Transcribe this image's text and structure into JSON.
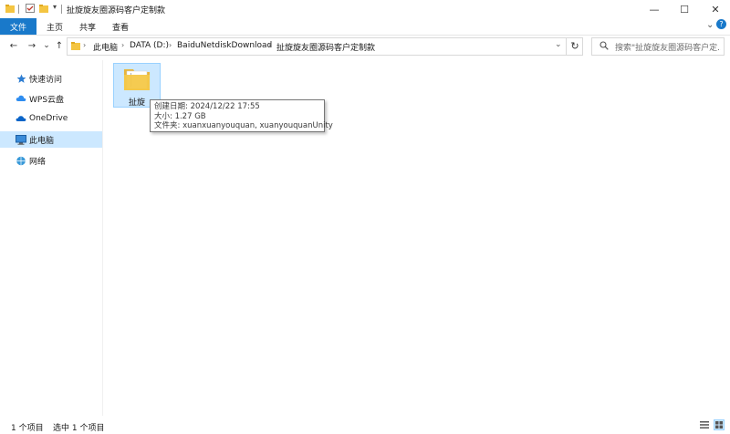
{
  "window": {
    "title": "扯旋旋友圈源码客户定制款",
    "controls": {
      "minimize": "—",
      "maximize": "☐",
      "close": "✕"
    }
  },
  "ribbon": {
    "tabs": [
      "文件",
      "主页",
      "共享",
      "查看"
    ],
    "active_tab": "文件",
    "accent_color": "#1979ca"
  },
  "nav": {
    "back": "←",
    "forward": "→",
    "recent": "⌄",
    "up": "↑",
    "refresh": "↻"
  },
  "breadcrumb": [
    "此电脑",
    "DATA (D:)",
    "BaiduNetdiskDownload",
    "扯旋旋友圈源码客户定制款"
  ],
  "search": {
    "placeholder": "搜索\"扯旋旋友圈源码客户定..."
  },
  "sidebar": {
    "items": [
      {
        "label": "快速访问",
        "icon": "star-icon"
      },
      {
        "label": "WPS云盘",
        "icon": "cloud-icon"
      },
      {
        "label": "OneDrive",
        "icon": "onedrive-icon"
      },
      {
        "label": "此电脑",
        "icon": "computer-icon",
        "selected": true
      },
      {
        "label": "网络",
        "icon": "network-icon"
      }
    ]
  },
  "files": [
    {
      "name": "扯旋",
      "type": "folder"
    }
  ],
  "tooltip": {
    "created": "创建日期: 2024/12/22 17:55",
    "size": "大小: 1.27 GB",
    "folders": "文件夹: xuanxuanyouquan, xuanyouquanUnity"
  },
  "status": {
    "count": "1 个项目",
    "selected": "选中 1 个项目"
  }
}
